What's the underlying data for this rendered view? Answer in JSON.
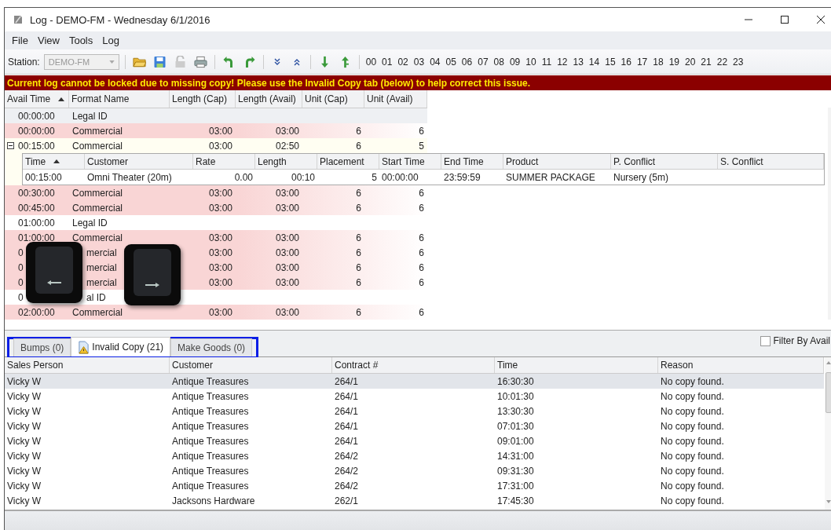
{
  "window": {
    "title": "Log - DEMO-FM - Wednesday 6/1/2016"
  },
  "menu": [
    "File",
    "View",
    "Tools",
    "Log"
  ],
  "toolbar": {
    "station_label": "Station:",
    "station": {
      "value": "DEMO-FM",
      "disabled": true
    },
    "hours": [
      "00",
      "01",
      "02",
      "03",
      "04",
      "05",
      "06",
      "07",
      "08",
      "09",
      "10",
      "11",
      "12",
      "13",
      "14",
      "15",
      "16",
      "17",
      "18",
      "19",
      "20",
      "21",
      "22",
      "23"
    ]
  },
  "banner": "Current log cannot be locked due to missing copy!  Please use the Invalid Copy tab (below) to help correct this issue.",
  "log_grid": {
    "columns": [
      "Avail Time",
      "Format Name",
      "Length (Cap)",
      "Length (Avail)",
      "Unit (Cap)",
      "Unit (Avail)"
    ],
    "rows": [
      {
        "kind": "legal",
        "selected": true,
        "covered": false,
        "cells": [
          "00:00:00",
          "Legal ID",
          "",
          "",
          "",
          ""
        ]
      },
      {
        "kind": "commercial",
        "selected": false,
        "covered": false,
        "cells": [
          "00:00:00",
          "Commercial",
          "03:00",
          "03:00",
          "6",
          "6"
        ]
      },
      {
        "kind": "commercial",
        "selected": false,
        "covered": false,
        "expanded": true,
        "cells": [
          "00:15:00",
          "Commercial",
          "03:00",
          "02:50",
          "6",
          "5"
        ],
        "detail": {
          "columns": [
            "Time",
            "Customer",
            "Rate",
            "Length",
            "Placement",
            "Start Time",
            "End Time",
            "Product",
            "P. Conflict",
            "S. Conflict"
          ],
          "rows": [
            [
              "00:15:00",
              "Omni Theater  (20m)",
              "0.00",
              "00:10",
              "5",
              "00:00:00",
              "23:59:59",
              "SUMMER PACKAGE",
              "Nursery (5m)",
              ""
            ]
          ]
        }
      },
      {
        "kind": "commercial",
        "selected": false,
        "covered": false,
        "cells": [
          "00:30:00",
          "Commercial",
          "03:00",
          "03:00",
          "6",
          "6"
        ]
      },
      {
        "kind": "commercial",
        "selected": false,
        "covered": false,
        "cells": [
          "00:45:00",
          "Commercial",
          "03:00",
          "03:00",
          "6",
          "6"
        ]
      },
      {
        "kind": "legal",
        "selected": false,
        "covered": false,
        "cells": [
          "01:00:00",
          "Legal ID",
          "",
          "",
          "",
          ""
        ]
      },
      {
        "kind": "commercial",
        "selected": false,
        "covered": false,
        "cells": [
          "01:00:00",
          "Commercial",
          "03:00",
          "03:00",
          "6",
          "6"
        ]
      },
      {
        "kind": "commercial",
        "selected": false,
        "covered": true,
        "cells": [
          "0",
          "mercial",
          "03:00",
          "03:00",
          "6",
          "6"
        ]
      },
      {
        "kind": "commercial",
        "selected": false,
        "covered": true,
        "cells": [
          "0",
          "mercial",
          "03:00",
          "03:00",
          "6",
          "6"
        ]
      },
      {
        "kind": "commercial",
        "selected": false,
        "covered": true,
        "cells": [
          "0",
          "mercial",
          "03:00",
          "03:00",
          "6",
          "6"
        ]
      },
      {
        "kind": "legal",
        "selected": false,
        "covered": true,
        "cells": [
          "0",
          "al ID",
          "",
          "",
          "",
          ""
        ]
      },
      {
        "kind": "commercial",
        "selected": false,
        "covered": false,
        "cells": [
          "02:00:00",
          "Commercial",
          "03:00",
          "03:00",
          "6",
          "6"
        ]
      }
    ]
  },
  "tabs": [
    {
      "label": "Bumps (0)",
      "selected": false
    },
    {
      "label": "Invalid Copy (21)",
      "selected": true
    },
    {
      "label": "Make Goods (0)",
      "selected": false
    }
  ],
  "filter": {
    "label": "Filter By Avail",
    "checked": false
  },
  "copy_table": {
    "columns": [
      "Sales Person",
      "Customer",
      "Contract #",
      "Time",
      "Reason"
    ],
    "rows": [
      {
        "selected": true,
        "cells": [
          "Vicky W",
          "Antique Treasures",
          "264/1",
          "16:30:30",
          "No copy found."
        ]
      },
      {
        "selected": false,
        "cells": [
          "Vicky W",
          "Antique Treasures",
          "264/1",
          "10:01:30",
          "No copy found."
        ]
      },
      {
        "selected": false,
        "cells": [
          "Vicky W",
          "Antique Treasures",
          "264/1",
          "13:30:30",
          "No copy found."
        ]
      },
      {
        "selected": false,
        "cells": [
          "Vicky W",
          "Antique Treasures",
          "264/1",
          "07:01:30",
          "No copy found."
        ]
      },
      {
        "selected": false,
        "cells": [
          "Vicky W",
          "Antique Treasures",
          "264/1",
          "09:01:00",
          "No copy found."
        ]
      },
      {
        "selected": false,
        "cells": [
          "Vicky W",
          "Antique Treasures",
          "264/2",
          "14:31:00",
          "No copy found."
        ]
      },
      {
        "selected": false,
        "cells": [
          "Vicky W",
          "Antique Treasures",
          "264/2",
          "09:31:30",
          "No copy found."
        ]
      },
      {
        "selected": false,
        "cells": [
          "Vicky W",
          "Antique Treasures",
          "264/2",
          "17:31:00",
          "No copy found."
        ]
      },
      {
        "selected": false,
        "cells": [
          "Vicky W",
          "Jacksons Hardware",
          "262/1",
          "17:45:30",
          "No copy found."
        ]
      }
    ]
  }
}
